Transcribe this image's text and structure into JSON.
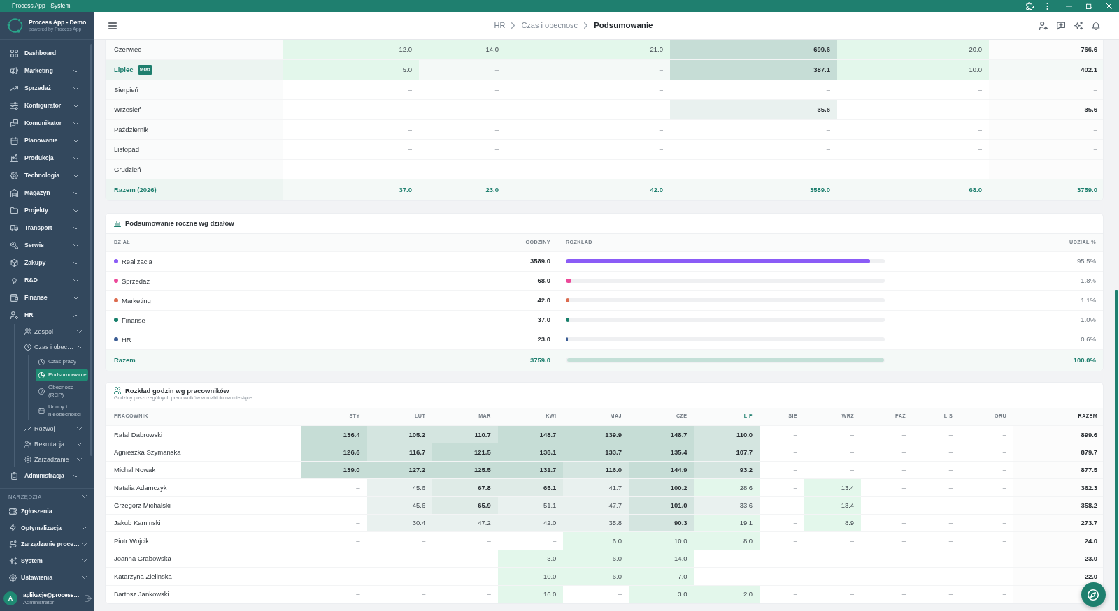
{
  "window": {
    "title": "Process App - System"
  },
  "sidebar": {
    "app_name": "Process App - Demo",
    "app_tagline": "powered by Process App",
    "items": [
      {
        "label": "Dashboard",
        "kind": "link",
        "selected": false
      },
      {
        "label": "Marketing",
        "kind": "group",
        "expanded": false,
        "selected": false
      },
      {
        "label": "Sprzedaż",
        "kind": "group",
        "expanded": false,
        "selected": false
      },
      {
        "label": "Konfigurator",
        "kind": "group",
        "expanded": false,
        "selected": false
      },
      {
        "label": "Komunikator",
        "kind": "group",
        "expanded": false,
        "selected": false
      },
      {
        "label": "Planowanie",
        "kind": "group",
        "expanded": false,
        "selected": false
      },
      {
        "label": "Produkcja",
        "kind": "group",
        "expanded": false,
        "selected": false
      },
      {
        "label": "Technologia",
        "kind": "group",
        "expanded": false,
        "selected": false
      },
      {
        "label": "Magazyn",
        "kind": "group",
        "expanded": false,
        "selected": false
      },
      {
        "label": "Projekty",
        "kind": "group",
        "expanded": false,
        "selected": false
      },
      {
        "label": "Transport",
        "kind": "group",
        "expanded": false,
        "selected": false
      },
      {
        "label": "Serwis",
        "kind": "group",
        "expanded": false,
        "selected": false
      },
      {
        "label": "Zakupy",
        "kind": "group",
        "expanded": false,
        "selected": false
      },
      {
        "label": "R&D",
        "kind": "group",
        "expanded": false,
        "selected": false
      },
      {
        "label": "Finanse",
        "kind": "group",
        "expanded": false,
        "selected": false
      },
      {
        "label": "HR",
        "kind": "group",
        "expanded": true,
        "selected": false,
        "children": [
          {
            "label": "Zespol",
            "kind": "group",
            "expanded": false,
            "selected": false
          },
          {
            "label": "Czas i obec…",
            "kind": "group",
            "expanded": true,
            "selected": false,
            "children": [
              {
                "label": "Czas pracy",
                "kind": "link",
                "selected": false
              },
              {
                "label": "Podsumowanie",
                "kind": "link",
                "selected": true
              },
              {
                "label": "Obecnosc (RCP)",
                "kind": "link",
                "selected": false
              },
              {
                "label": "Urlopy i nieobecnosci",
                "kind": "link",
                "selected": false
              }
            ]
          },
          {
            "label": "Rozwoj",
            "kind": "group",
            "expanded": false,
            "selected": false
          },
          {
            "label": "Rekrutacja",
            "kind": "group",
            "expanded": false,
            "selected": false
          },
          {
            "label": "Zarzadzanie",
            "kind": "group",
            "expanded": false,
            "selected": false
          }
        ]
      },
      {
        "label": "Administracja",
        "kind": "group",
        "expanded": false,
        "selected": false
      }
    ],
    "tools": {
      "title": "NARZĘDZIA",
      "items": [
        {
          "label": "Zgłoszenia",
          "kind": "link",
          "selected": false
        },
        {
          "label": "Optymalizacja",
          "kind": "group",
          "expanded": false,
          "selected": false
        },
        {
          "label": "Zarządzanie proce…",
          "kind": "group",
          "expanded": false,
          "selected": false
        },
        {
          "label": "System",
          "kind": "group",
          "expanded": false,
          "selected": false
        },
        {
          "label": "Ustawienia",
          "kind": "group",
          "expanded": false,
          "selected": false
        }
      ]
    },
    "user": {
      "initial": "A",
      "email": "aplikacje@process…",
      "role": "Administrator"
    }
  },
  "header": {
    "breadcrumb": {
      "links": [
        "HR",
        "Czas i obecnosc"
      ],
      "current": "Podsumowanie"
    }
  },
  "monthly_table": {
    "rows": [
      {
        "month": "Czerwiec",
        "current": false,
        "cells": [
          {
            "value": "12.0",
            "color": "#e3f7eb",
            "bold": false
          },
          {
            "value": "14.0",
            "color": "#e3f7eb",
            "bold": false
          },
          {
            "value": "21.0",
            "color": "#e3f7eb",
            "bold": false
          },
          {
            "value": "699.6",
            "color": "#c6ddd6",
            "bold": true
          },
          {
            "value": "20.0",
            "color": "#e3f7eb",
            "bold": false
          }
        ],
        "total": "766.6"
      },
      {
        "month": "Lipiec",
        "current": true,
        "badge": "teraz",
        "cells": [
          {
            "value": "5.0",
            "color": "#e3f7eb",
            "bold": false
          },
          {
            "value": "–",
            "bold": false
          },
          {
            "value": "–",
            "bold": false
          },
          {
            "value": "387.1",
            "color": "#c6ddd6",
            "bold": true
          },
          {
            "value": "10.0",
            "color": "#e3f7eb",
            "bold": false
          }
        ],
        "total": "402.1"
      },
      {
        "month": "Sierpień",
        "current": false,
        "cells": [
          {
            "value": "–",
            "bold": false
          },
          {
            "value": "–",
            "bold": false
          },
          {
            "value": "–",
            "bold": false
          },
          {
            "value": "–",
            "bold": false
          },
          {
            "value": "–",
            "bold": false
          }
        ],
        "total": "–"
      },
      {
        "month": "Wrzesień",
        "current": false,
        "cells": [
          {
            "value": "–",
            "bold": false
          },
          {
            "value": "–",
            "bold": false
          },
          {
            "value": "–",
            "bold": false
          },
          {
            "value": "35.6",
            "color": "#e9f1ef",
            "bold": true
          },
          {
            "value": "–",
            "bold": false
          }
        ],
        "total": "35.6"
      },
      {
        "month": "Październik",
        "current": false,
        "cells": [
          {
            "value": "–",
            "bold": false
          },
          {
            "value": "–",
            "bold": false
          },
          {
            "value": "–",
            "bold": false
          },
          {
            "value": "–",
            "bold": false
          },
          {
            "value": "–",
            "bold": false
          }
        ],
        "total": "–"
      },
      {
        "month": "Listopad",
        "current": false,
        "cells": [
          {
            "value": "–",
            "bold": false
          },
          {
            "value": "–",
            "bold": false
          },
          {
            "value": "–",
            "bold": false
          },
          {
            "value": "–",
            "bold": false
          },
          {
            "value": "–",
            "bold": false
          }
        ],
        "total": "–"
      },
      {
        "month": "Grudzień",
        "current": false,
        "cells": [
          {
            "value": "–",
            "bold": false
          },
          {
            "value": "–",
            "bold": false
          },
          {
            "value": "–",
            "bold": false
          },
          {
            "value": "–",
            "bold": false
          },
          {
            "value": "–",
            "bold": false
          }
        ],
        "total": "–"
      }
    ],
    "footer": {
      "label": "Razem (2026)",
      "cells": [
        "37.0",
        "23.0",
        "42.0",
        "3589.0",
        "68.0"
      ],
      "total": "3759.0"
    }
  },
  "department_summary": {
    "title": "Podsumowanie roczne wg działów",
    "columns": [
      "DZIAŁ",
      "GODZINY",
      "ROZKŁAD",
      "UDZIAŁ %"
    ],
    "rows": [
      {
        "name": "Realizacja",
        "color": "#8b5cf6",
        "hours": "3589.0",
        "level": 0.955,
        "share": "95.5%"
      },
      {
        "name": "Sprzedaz",
        "color": "#ec4899",
        "hours": "68.0",
        "level": 0.018,
        "share": "1.8%"
      },
      {
        "name": "Marketing",
        "color": "#dc6b4e",
        "hours": "42.0",
        "level": 0.011,
        "share": "1.1%"
      },
      {
        "name": "Finanse",
        "color": "#17806b",
        "hours": "37.0",
        "level": 0.01,
        "share": "1.0%"
      },
      {
        "name": "HR",
        "color": "#3b5c94",
        "hours": "23.0",
        "level": 0.006,
        "share": "0.6%"
      }
    ],
    "footer": {
      "label": "Razem",
      "hours": "3759.0",
      "level": 1.0,
      "share": "100.0%"
    }
  },
  "employee_table": {
    "title": "Rozkład godzin wg pracowników",
    "subtitle": "Godziny poszczególnych pracowników w rozbiciu na miesiące",
    "name_header": "PRACOWNIK",
    "columns": [
      {
        "label": "STY",
        "current": false
      },
      {
        "label": "LUT",
        "current": false
      },
      {
        "label": "MAR",
        "current": false
      },
      {
        "label": "KWI",
        "current": false
      },
      {
        "label": "MAJ",
        "current": false
      },
      {
        "label": "CZE",
        "current": false
      },
      {
        "label": "LIP",
        "current": true
      },
      {
        "label": "SIE",
        "current": false
      },
      {
        "label": "WRZ",
        "current": false
      },
      {
        "label": "PAŹ",
        "current": false
      },
      {
        "label": "LIS",
        "current": false
      },
      {
        "label": "GRU",
        "current": false
      }
    ],
    "total_header": "RAZEM",
    "rows": [
      {
        "name": "Rafal Dabrowski",
        "cells": [
          {
            "value": "136.4",
            "color": "#c6ddd6",
            "bold": true
          },
          {
            "value": "105.2",
            "color": "#d4e5e0",
            "bold": true
          },
          {
            "value": "110.7",
            "color": "#d4e5e0",
            "bold": true
          },
          {
            "value": "148.7",
            "color": "#c6ddd6",
            "bold": true
          },
          {
            "value": "139.9",
            "color": "#c6ddd6",
            "bold": true
          },
          {
            "value": "148.7",
            "color": "#c6ddd6",
            "bold": true
          },
          {
            "value": "110.0",
            "color": "#d4e5e0",
            "bold": true
          },
          {
            "value": "–",
            "bold": false
          },
          {
            "value": "–",
            "bold": false
          },
          {
            "value": "–",
            "bold": false
          },
          {
            "value": "–",
            "bold": false
          },
          {
            "value": "–",
            "bold": false
          }
        ],
        "total": "899.6"
      },
      {
        "name": "Agnieszka Szymanska",
        "cells": [
          {
            "value": "126.6",
            "color": "#c6ddd6",
            "bold": true
          },
          {
            "value": "116.7",
            "color": "#d4e5e0",
            "bold": true
          },
          {
            "value": "121.5",
            "color": "#c6ddd6",
            "bold": true
          },
          {
            "value": "138.1",
            "color": "#c6ddd6",
            "bold": true
          },
          {
            "value": "133.7",
            "color": "#c6ddd6",
            "bold": true
          },
          {
            "value": "135.4",
            "color": "#c6ddd6",
            "bold": true
          },
          {
            "value": "107.7",
            "color": "#d4e5e0",
            "bold": true
          },
          {
            "value": "–",
            "bold": false
          },
          {
            "value": "–",
            "bold": false
          },
          {
            "value": "–",
            "bold": false
          },
          {
            "value": "–",
            "bold": false
          },
          {
            "value": "–",
            "bold": false
          }
        ],
        "total": "879.7"
      },
      {
        "name": "Michal Nowak",
        "cells": [
          {
            "value": "139.0",
            "color": "#c6ddd6",
            "bold": true
          },
          {
            "value": "127.2",
            "color": "#c6ddd6",
            "bold": true
          },
          {
            "value": "125.5",
            "color": "#c6ddd6",
            "bold": true
          },
          {
            "value": "131.7",
            "color": "#c6ddd6",
            "bold": true
          },
          {
            "value": "116.0",
            "color": "#d4e5e0",
            "bold": true
          },
          {
            "value": "144.9",
            "color": "#c6ddd6",
            "bold": true
          },
          {
            "value": "93.2",
            "color": "#d4e5e0",
            "bold": true
          },
          {
            "value": "–",
            "bold": false
          },
          {
            "value": "–",
            "bold": false
          },
          {
            "value": "–",
            "bold": false
          },
          {
            "value": "–",
            "bold": false
          },
          {
            "value": "–",
            "bold": false
          }
        ],
        "total": "877.5"
      },
      {
        "name": "Natalia Adamczyk",
        "cells": [
          {
            "value": "–",
            "bold": false
          },
          {
            "value": "45.6",
            "color": "#e9f1ef",
            "bold": false
          },
          {
            "value": "67.8",
            "color": "#dfebe7",
            "bold": true
          },
          {
            "value": "65.1",
            "color": "#dfebe7",
            "bold": true
          },
          {
            "value": "41.7",
            "color": "#e9f1ef",
            "bold": false
          },
          {
            "value": "100.2",
            "color": "#d4e5e0",
            "bold": true
          },
          {
            "value": "28.6",
            "color": "#e3f7eb",
            "bold": false
          },
          {
            "value": "–",
            "bold": false
          },
          {
            "value": "13.4",
            "color": "#e3f7eb",
            "bold": false
          },
          {
            "value": "–",
            "bold": false
          },
          {
            "value": "–",
            "bold": false
          },
          {
            "value": "–",
            "bold": false
          }
        ],
        "total": "362.3"
      },
      {
        "name": "Grzegorz Michalski",
        "cells": [
          {
            "value": "–",
            "bold": false
          },
          {
            "value": "45.6",
            "color": "#e9f1ef",
            "bold": false
          },
          {
            "value": "65.9",
            "color": "#dfebe7",
            "bold": true
          },
          {
            "value": "51.1",
            "color": "#e9f1ef",
            "bold": false
          },
          {
            "value": "47.7",
            "color": "#e9f1ef",
            "bold": false
          },
          {
            "value": "101.0",
            "color": "#d4e5e0",
            "bold": true
          },
          {
            "value": "33.6",
            "color": "#e9f1ef",
            "bold": false
          },
          {
            "value": "–",
            "bold": false
          },
          {
            "value": "13.4",
            "color": "#e3f7eb",
            "bold": false
          },
          {
            "value": "–",
            "bold": false
          },
          {
            "value": "–",
            "bold": false
          },
          {
            "value": "–",
            "bold": false
          }
        ],
        "total": "358.2"
      },
      {
        "name": "Jakub Kaminski",
        "cells": [
          {
            "value": "–",
            "bold": false
          },
          {
            "value": "30.4",
            "color": "#e9f1ef",
            "bold": false
          },
          {
            "value": "47.2",
            "color": "#e9f1ef",
            "bold": false
          },
          {
            "value": "42.0",
            "color": "#e9f1ef",
            "bold": false
          },
          {
            "value": "35.8",
            "color": "#e9f1ef",
            "bold": false
          },
          {
            "value": "90.3",
            "color": "#d4e5e0",
            "bold": true
          },
          {
            "value": "19.1",
            "color": "#e3f7eb",
            "bold": false
          },
          {
            "value": "–",
            "bold": false
          },
          {
            "value": "8.9",
            "color": "#e3f7eb",
            "bold": false
          },
          {
            "value": "–",
            "bold": false
          },
          {
            "value": "–",
            "bold": false
          },
          {
            "value": "–",
            "bold": false
          }
        ],
        "total": "273.7"
      },
      {
        "name": "Piotr Wojcik",
        "cells": [
          {
            "value": "–",
            "bold": false
          },
          {
            "value": "–",
            "bold": false
          },
          {
            "value": "–",
            "bold": false
          },
          {
            "value": "–",
            "bold": false
          },
          {
            "value": "6.0",
            "color": "#e3f7eb",
            "bold": false
          },
          {
            "value": "10.0",
            "color": "#e3f7eb",
            "bold": false
          },
          {
            "value": "8.0",
            "color": "#e3f7eb",
            "bold": false
          },
          {
            "value": "–",
            "bold": false
          },
          {
            "value": "–",
            "bold": false
          },
          {
            "value": "–",
            "bold": false
          },
          {
            "value": "–",
            "bold": false
          },
          {
            "value": "–",
            "bold": false
          }
        ],
        "total": "24.0"
      },
      {
        "name": "Joanna Grabowska",
        "cells": [
          {
            "value": "–",
            "bold": false
          },
          {
            "value": "–",
            "bold": false
          },
          {
            "value": "–",
            "bold": false
          },
          {
            "value": "3.0",
            "color": "#e3f7eb",
            "bold": false
          },
          {
            "value": "6.0",
            "color": "#e3f7eb",
            "bold": false
          },
          {
            "value": "14.0",
            "color": "#e3f7eb",
            "bold": false
          },
          {
            "value": "–",
            "bold": false
          },
          {
            "value": "–",
            "bold": false
          },
          {
            "value": "–",
            "bold": false
          },
          {
            "value": "–",
            "bold": false
          },
          {
            "value": "–",
            "bold": false
          },
          {
            "value": "–",
            "bold": false
          }
        ],
        "total": "23.0"
      },
      {
        "name": "Katarzyna Zielinska",
        "cells": [
          {
            "value": "–",
            "bold": false
          },
          {
            "value": "–",
            "bold": false
          },
          {
            "value": "–",
            "bold": false
          },
          {
            "value": "10.0",
            "color": "#e3f7eb",
            "bold": false
          },
          {
            "value": "6.0",
            "color": "#e3f7eb",
            "bold": false
          },
          {
            "value": "7.0",
            "color": "#e3f7eb",
            "bold": false
          },
          {
            "value": "–",
            "bold": false
          },
          {
            "value": "–",
            "bold": false
          },
          {
            "value": "–",
            "bold": false
          },
          {
            "value": "–",
            "bold": false
          },
          {
            "value": "–",
            "bold": false
          },
          {
            "value": "–",
            "bold": false
          }
        ],
        "total": "22.0"
      },
      {
        "name": "Bartosz Jankowski",
        "cells": [
          {
            "value": "–",
            "bold": false
          },
          {
            "value": "–",
            "bold": false
          },
          {
            "value": "–",
            "bold": false
          },
          {
            "value": "16.0",
            "color": "#e3f7eb",
            "bold": false
          },
          {
            "value": "–",
            "bold": false
          },
          {
            "value": "3.0",
            "color": "#e3f7eb",
            "bold": false
          },
          {
            "value": "2.0",
            "color": "#e3f7eb",
            "bold": false
          },
          {
            "value": "–",
            "bold": false
          },
          {
            "value": "–",
            "bold": false
          },
          {
            "value": "–",
            "bold": false
          },
          {
            "value": "–",
            "bold": false
          },
          {
            "value": "–",
            "bold": false
          }
        ]
      }
    ]
  }
}
